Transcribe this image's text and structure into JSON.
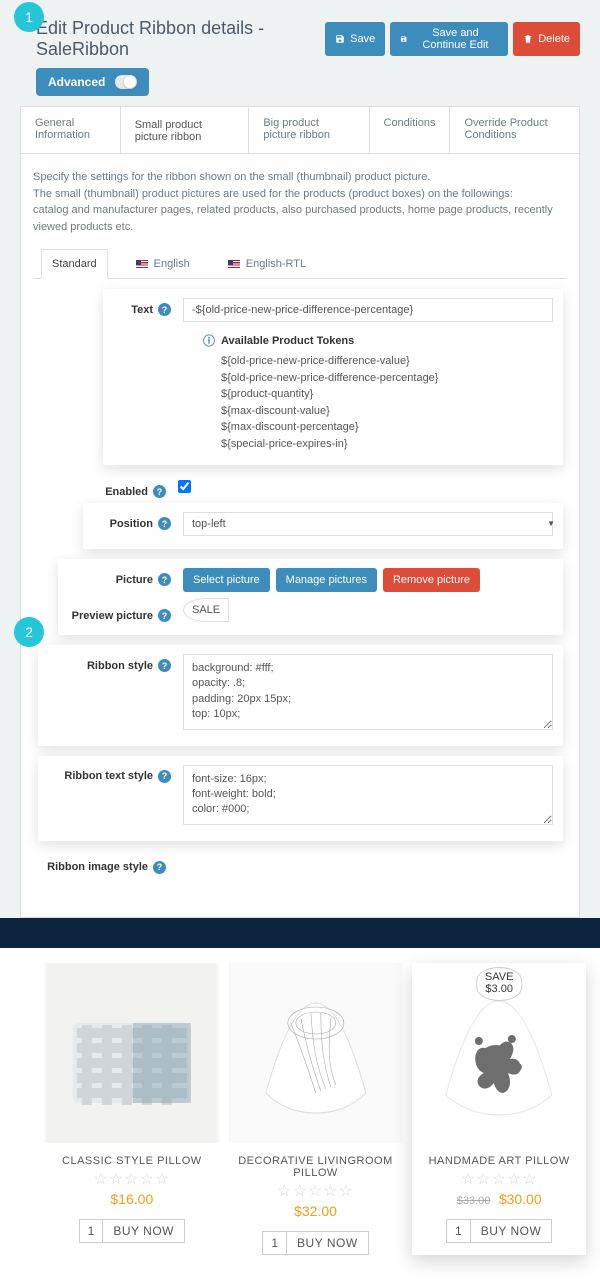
{
  "step_labels": {
    "one": "1",
    "two": "2"
  },
  "header": {
    "title": "Edit Product Ribbon details - SaleRibbon",
    "save": "Save",
    "save_continue": "Save and Continue Edit",
    "delete": "Delete",
    "advanced": "Advanced"
  },
  "tabs": {
    "general": "General Information",
    "small": "Small product picture ribbon",
    "big": "Big product picture ribbon",
    "conditions": "Conditions",
    "override": "Override Product Conditions"
  },
  "helper": {
    "line1": "Specify the settings for the ribbon shown on the small (thumbnail) product picture.",
    "line2": "The small (thumbnail) product pictures are used for the products (product boxes) on the followings:",
    "line3": "catalog and manufacturer pages, related products, also purchased products, home page products, recently viewed products etc."
  },
  "subtabs": {
    "standard": "Standard",
    "english": "English",
    "english_rtl": "English-RTL"
  },
  "form": {
    "text_label": "Text",
    "text_value": "-${old-price-new-price-difference-percentage}",
    "tokens_title": "Available Product Tokens",
    "tokens": [
      "${old-price-new-price-difference-value}",
      "${old-price-new-price-difference-percentage}",
      "${product-quantity}",
      "${max-discount-value}",
      "${max-discount-percentage}",
      "${special-price-expires-in}"
    ],
    "enabled_label": "Enabled",
    "position_label": "Position",
    "position_value": "top-left",
    "picture_label": "Picture",
    "select_picture": "Select picture",
    "manage_pictures": "Manage pictures",
    "remove_picture": "Remove picture",
    "preview_picture_label": "Preview picture",
    "preview_tag": "SALE",
    "ribbon_style_label": "Ribbon style",
    "ribbon_style_value": "background: #fff;\nopacity: .8;\npadding: 20px 15px;\ntop: 10px;",
    "ribbon_text_style_label": "Ribbon text style",
    "ribbon_text_style_value": "font-size: 16px;\nfont-weight: bold;\ncolor: #000;",
    "ribbon_image_style_label": "Ribbon image style"
  },
  "products": {
    "ribbon_line1": "SAVE",
    "ribbon_line2": "$3.00",
    "qty": "1",
    "buy_now": "BUY NOW",
    "items": [
      {
        "name": "CLASSIC STYLE PILLOW",
        "price": "$16.00"
      },
      {
        "name": "DECORATIVE LIVINGROOM PILLOW",
        "price": "$32.00"
      },
      {
        "name": "HANDMADE ART PILLOW",
        "old_price": "$33.00",
        "price": "$30.00"
      }
    ]
  }
}
